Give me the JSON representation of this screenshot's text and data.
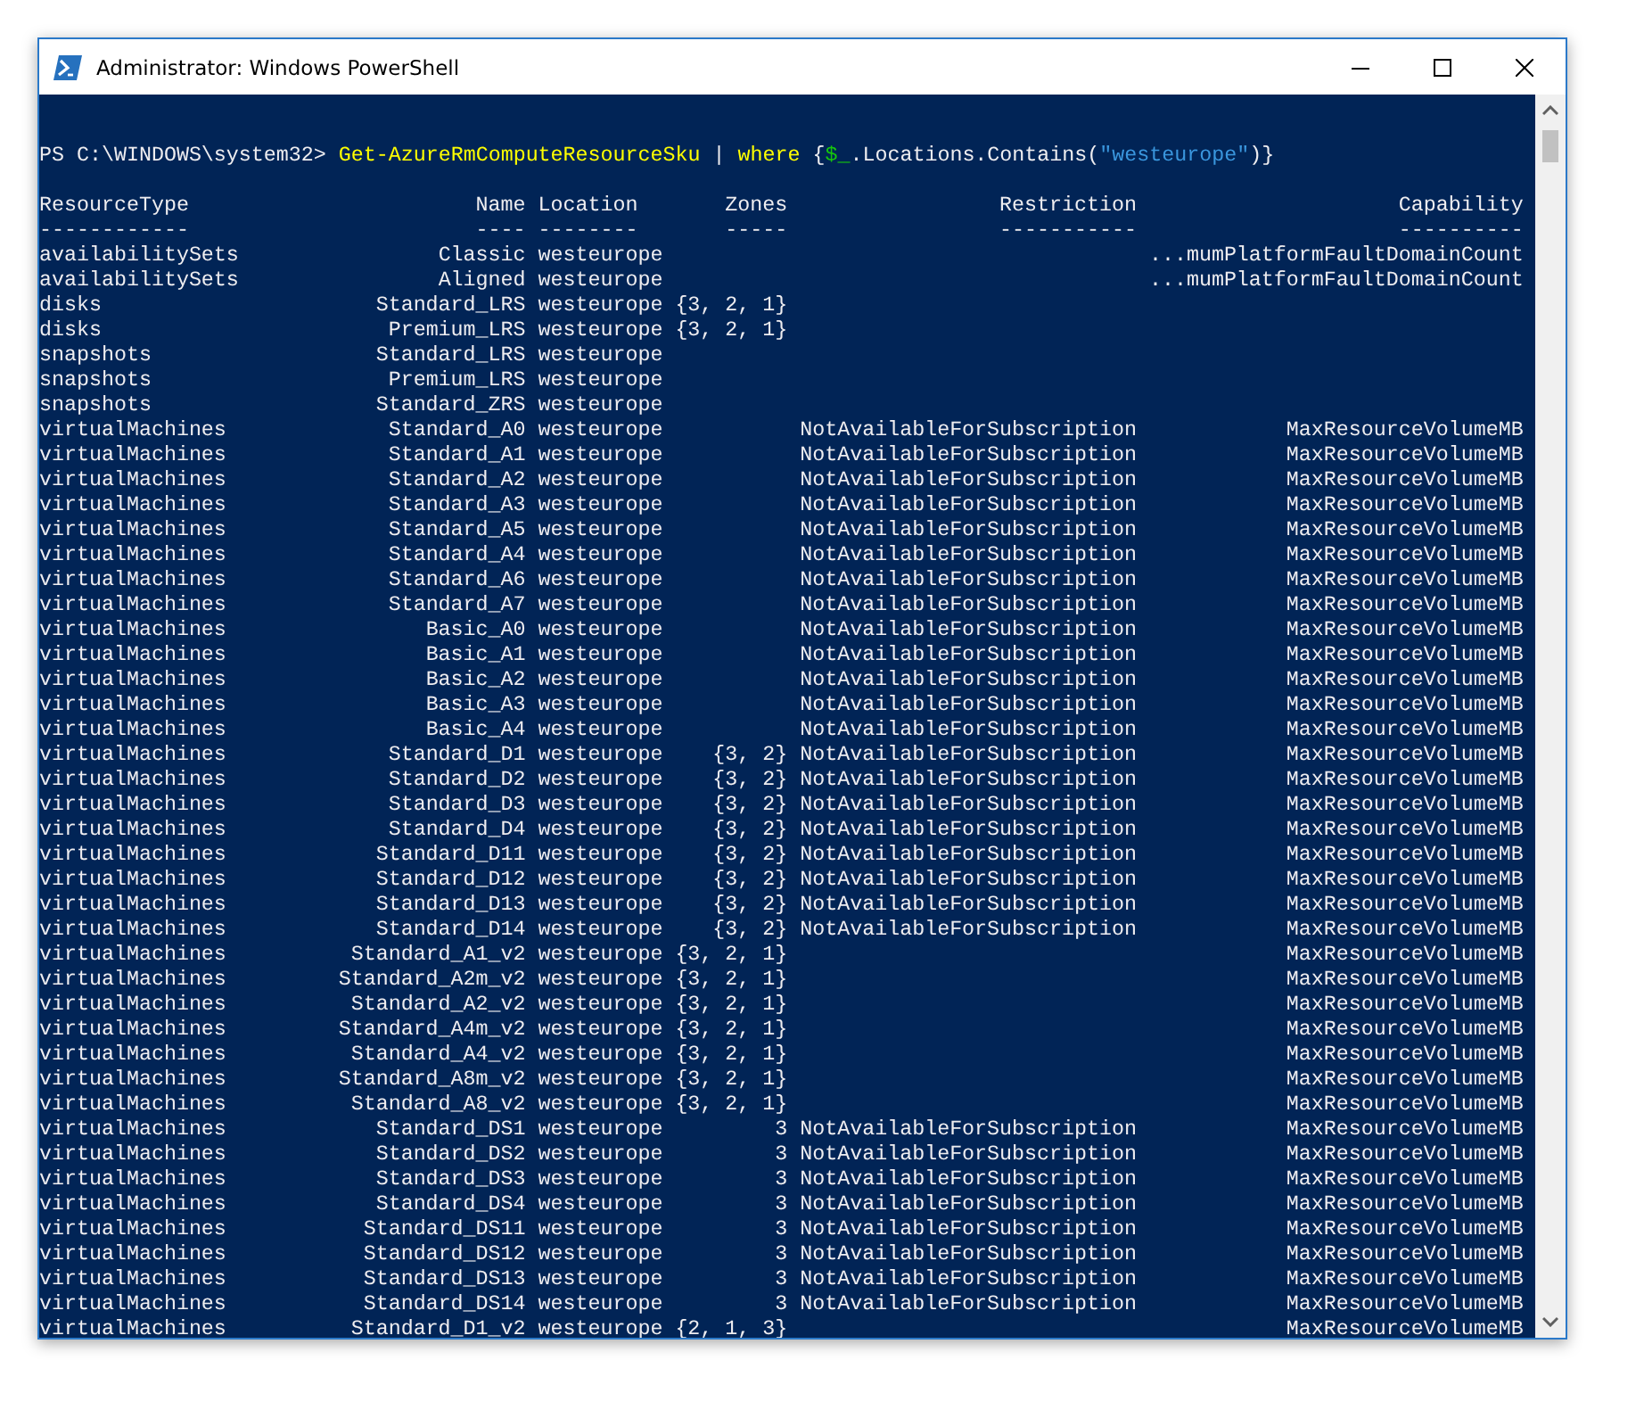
{
  "window": {
    "title": "Administrator: Windows PowerShell"
  },
  "console": {
    "command": [
      {
        "kind": "prompt",
        "text": "PS C:\\WINDOWS\\system32> "
      },
      {
        "kind": "command",
        "text": "Get-AzureRmComputeResourceSku"
      },
      {
        "kind": "plain",
        "text": " | "
      },
      {
        "kind": "command",
        "text": "where"
      },
      {
        "kind": "plain",
        "text": " {"
      },
      {
        "kind": "variable",
        "text": "$_"
      },
      {
        "kind": "plain",
        "text": ".Locations.Contains("
      },
      {
        "kind": "string",
        "text": "\"westeurope\""
      },
      {
        "kind": "plain",
        "text": ")}"
      }
    ],
    "columns": [
      {
        "label": "ResourceType",
        "underline": "------------"
      },
      {
        "label": "Name",
        "underline": "----"
      },
      {
        "label": "Location",
        "underline": "--------"
      },
      {
        "label": "Zones",
        "underline": "-----"
      },
      {
        "label": "Restriction",
        "underline": "-----------"
      },
      {
        "label": "Capability",
        "underline": "----------"
      }
    ],
    "rows": [
      {
        "type": "availabilitySets",
        "name": "Classic",
        "location": "westeurope",
        "capability": "...mumPlatformFaultDomainCount"
      },
      {
        "type": "availabilitySets",
        "name": "Aligned",
        "location": "westeurope",
        "capability": "...mumPlatformFaultDomainCount"
      },
      {
        "type": "disks",
        "name": "Standard_LRS",
        "location": "westeurope",
        "zones": "{3, 2, 1}"
      },
      {
        "type": "disks",
        "name": "Premium_LRS",
        "location": "westeurope",
        "zones": "{3, 2, 1}"
      },
      {
        "type": "snapshots",
        "name": "Standard_LRS",
        "location": "westeurope"
      },
      {
        "type": "snapshots",
        "name": "Premium_LRS",
        "location": "westeurope"
      },
      {
        "type": "snapshots",
        "name": "Standard_ZRS",
        "location": "westeurope"
      },
      {
        "type": "virtualMachines",
        "name": "Standard_A0",
        "location": "westeurope",
        "restriction": "NotAvailableForSubscription",
        "capability": "MaxResourceVolumeMB"
      },
      {
        "type": "virtualMachines",
        "name": "Standard_A1",
        "location": "westeurope",
        "restriction": "NotAvailableForSubscription",
        "capability": "MaxResourceVolumeMB"
      },
      {
        "type": "virtualMachines",
        "name": "Standard_A2",
        "location": "westeurope",
        "restriction": "NotAvailableForSubscription",
        "capability": "MaxResourceVolumeMB"
      },
      {
        "type": "virtualMachines",
        "name": "Standard_A3",
        "location": "westeurope",
        "restriction": "NotAvailableForSubscription",
        "capability": "MaxResourceVolumeMB"
      },
      {
        "type": "virtualMachines",
        "name": "Standard_A5",
        "location": "westeurope",
        "restriction": "NotAvailableForSubscription",
        "capability": "MaxResourceVolumeMB"
      },
      {
        "type": "virtualMachines",
        "name": "Standard_A4",
        "location": "westeurope",
        "restriction": "NotAvailableForSubscription",
        "capability": "MaxResourceVolumeMB"
      },
      {
        "type": "virtualMachines",
        "name": "Standard_A6",
        "location": "westeurope",
        "restriction": "NotAvailableForSubscription",
        "capability": "MaxResourceVolumeMB"
      },
      {
        "type": "virtualMachines",
        "name": "Standard_A7",
        "location": "westeurope",
        "restriction": "NotAvailableForSubscription",
        "capability": "MaxResourceVolumeMB"
      },
      {
        "type": "virtualMachines",
        "name": "Basic_A0",
        "location": "westeurope",
        "restriction": "NotAvailableForSubscription",
        "capability": "MaxResourceVolumeMB"
      },
      {
        "type": "virtualMachines",
        "name": "Basic_A1",
        "location": "westeurope",
        "restriction": "NotAvailableForSubscription",
        "capability": "MaxResourceVolumeMB"
      },
      {
        "type": "virtualMachines",
        "name": "Basic_A2",
        "location": "westeurope",
        "restriction": "NotAvailableForSubscription",
        "capability": "MaxResourceVolumeMB"
      },
      {
        "type": "virtualMachines",
        "name": "Basic_A3",
        "location": "westeurope",
        "restriction": "NotAvailableForSubscription",
        "capability": "MaxResourceVolumeMB"
      },
      {
        "type": "virtualMachines",
        "name": "Basic_A4",
        "location": "westeurope",
        "restriction": "NotAvailableForSubscription",
        "capability": "MaxResourceVolumeMB"
      },
      {
        "type": "virtualMachines",
        "name": "Standard_D1",
        "location": "westeurope",
        "zones": "{3, 2}",
        "restriction": "NotAvailableForSubscription",
        "capability": "MaxResourceVolumeMB"
      },
      {
        "type": "virtualMachines",
        "name": "Standard_D2",
        "location": "westeurope",
        "zones": "{3, 2}",
        "restriction": "NotAvailableForSubscription",
        "capability": "MaxResourceVolumeMB"
      },
      {
        "type": "virtualMachines",
        "name": "Standard_D3",
        "location": "westeurope",
        "zones": "{3, 2}",
        "restriction": "NotAvailableForSubscription",
        "capability": "MaxResourceVolumeMB"
      },
      {
        "type": "virtualMachines",
        "name": "Standard_D4",
        "location": "westeurope",
        "zones": "{3, 2}",
        "restriction": "NotAvailableForSubscription",
        "capability": "MaxResourceVolumeMB"
      },
      {
        "type": "virtualMachines",
        "name": "Standard_D11",
        "location": "westeurope",
        "zones": "{3, 2}",
        "restriction": "NotAvailableForSubscription",
        "capability": "MaxResourceVolumeMB"
      },
      {
        "type": "virtualMachines",
        "name": "Standard_D12",
        "location": "westeurope",
        "zones": "{3, 2}",
        "restriction": "NotAvailableForSubscription",
        "capability": "MaxResourceVolumeMB"
      },
      {
        "type": "virtualMachines",
        "name": "Standard_D13",
        "location": "westeurope",
        "zones": "{3, 2}",
        "restriction": "NotAvailableForSubscription",
        "capability": "MaxResourceVolumeMB"
      },
      {
        "type": "virtualMachines",
        "name": "Standard_D14",
        "location": "westeurope",
        "zones": "{3, 2}",
        "restriction": "NotAvailableForSubscription",
        "capability": "MaxResourceVolumeMB"
      },
      {
        "type": "virtualMachines",
        "name": "Standard_A1_v2",
        "location": "westeurope",
        "zones": "{3, 2, 1}",
        "capability": "MaxResourceVolumeMB"
      },
      {
        "type": "virtualMachines",
        "name": "Standard_A2m_v2",
        "location": "westeurope",
        "zones": "{3, 2, 1}",
        "capability": "MaxResourceVolumeMB"
      },
      {
        "type": "virtualMachines",
        "name": "Standard_A2_v2",
        "location": "westeurope",
        "zones": "{3, 2, 1}",
        "capability": "MaxResourceVolumeMB"
      },
      {
        "type": "virtualMachines",
        "name": "Standard_A4m_v2",
        "location": "westeurope",
        "zones": "{3, 2, 1}",
        "capability": "MaxResourceVolumeMB"
      },
      {
        "type": "virtualMachines",
        "name": "Standard_A4_v2",
        "location": "westeurope",
        "zones": "{3, 2, 1}",
        "capability": "MaxResourceVolumeMB"
      },
      {
        "type": "virtualMachines",
        "name": "Standard_A8m_v2",
        "location": "westeurope",
        "zones": "{3, 2, 1}",
        "capability": "MaxResourceVolumeMB"
      },
      {
        "type": "virtualMachines",
        "name": "Standard_A8_v2",
        "location": "westeurope",
        "zones": "{3, 2, 1}",
        "capability": "MaxResourceVolumeMB"
      },
      {
        "type": "virtualMachines",
        "name": "Standard_DS1",
        "location": "westeurope",
        "zones": "3",
        "restriction": "NotAvailableForSubscription",
        "capability": "MaxResourceVolumeMB"
      },
      {
        "type": "virtualMachines",
        "name": "Standard_DS2",
        "location": "westeurope",
        "zones": "3",
        "restriction": "NotAvailableForSubscription",
        "capability": "MaxResourceVolumeMB"
      },
      {
        "type": "virtualMachines",
        "name": "Standard_DS3",
        "location": "westeurope",
        "zones": "3",
        "restriction": "NotAvailableForSubscription",
        "capability": "MaxResourceVolumeMB"
      },
      {
        "type": "virtualMachines",
        "name": "Standard_DS4",
        "location": "westeurope",
        "zones": "3",
        "restriction": "NotAvailableForSubscription",
        "capability": "MaxResourceVolumeMB"
      },
      {
        "type": "virtualMachines",
        "name": "Standard_DS11",
        "location": "westeurope",
        "zones": "3",
        "restriction": "NotAvailableForSubscription",
        "capability": "MaxResourceVolumeMB"
      },
      {
        "type": "virtualMachines",
        "name": "Standard_DS12",
        "location": "westeurope",
        "zones": "3",
        "restriction": "NotAvailableForSubscription",
        "capability": "MaxResourceVolumeMB"
      },
      {
        "type": "virtualMachines",
        "name": "Standard_DS13",
        "location": "westeurope",
        "zones": "3",
        "restriction": "NotAvailableForSubscription",
        "capability": "MaxResourceVolumeMB"
      },
      {
        "type": "virtualMachines",
        "name": "Standard_DS14",
        "location": "westeurope",
        "zones": "3",
        "restriction": "NotAvailableForSubscription",
        "capability": "MaxResourceVolumeMB"
      },
      {
        "type": "virtualMachines",
        "name": "Standard_D1_v2",
        "location": "westeurope",
        "zones": "{2, 1, 3}",
        "capability": "MaxResourceVolumeMB"
      }
    ]
  }
}
